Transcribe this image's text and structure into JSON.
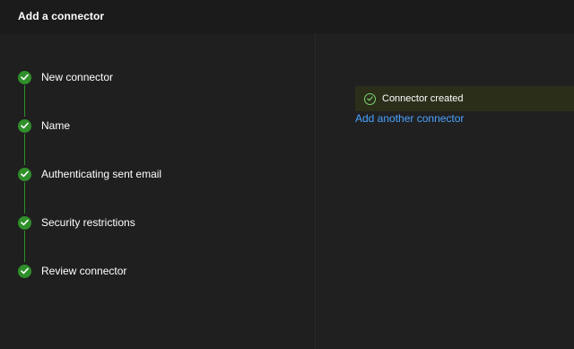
{
  "header": {
    "title": "Add a connector"
  },
  "steps": [
    {
      "label": "New connector",
      "status": "complete"
    },
    {
      "label": "Name",
      "status": "complete"
    },
    {
      "label": "Authenticating sent email",
      "status": "complete"
    },
    {
      "label": "Security restrictions",
      "status": "complete"
    },
    {
      "label": "Review connector",
      "status": "complete"
    }
  ],
  "status": {
    "message": "Connector created",
    "icon": "check-circle-icon"
  },
  "actions": {
    "add_another": "Add another connector"
  },
  "colors": {
    "background": "#1f1f1f",
    "header": "#1b1b1b",
    "success": "#2f8f2a",
    "success_light": "#7bd36f",
    "banner": "#2b2f1a",
    "link": "#4aa3ff",
    "text": "#ffffff"
  }
}
